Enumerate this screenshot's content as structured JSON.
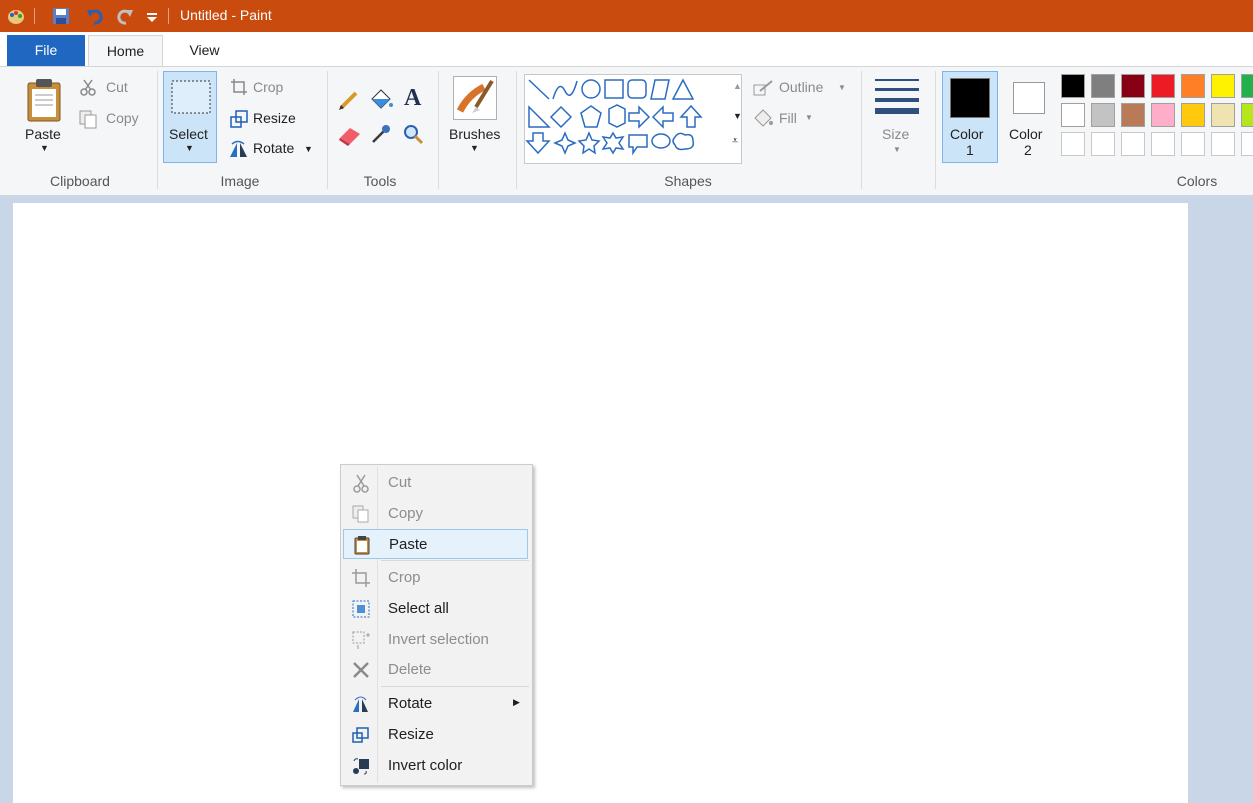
{
  "titlebar": {
    "title": "Untitled - Paint"
  },
  "tabs": {
    "file": "File",
    "home": "Home",
    "view": "View"
  },
  "clipboard": {
    "paste": "Paste",
    "cut": "Cut",
    "copy": "Copy",
    "group": "Clipboard"
  },
  "image": {
    "select": "Select",
    "crop": "Crop",
    "resize": "Resize",
    "rotate": "Rotate",
    "group": "Image"
  },
  "tools": {
    "group": "Tools"
  },
  "brushes": {
    "label": "Brushes"
  },
  "shapes": {
    "outline": "Outline",
    "fill": "Fill",
    "group": "Shapes"
  },
  "size": {
    "label": "Size"
  },
  "colors": {
    "color1_line1": "Color",
    "color1_line2": "1",
    "color2_line1": "Color",
    "color2_line2": "2",
    "group": "Colors",
    "color1": "#000000",
    "color2": "#ffffff",
    "palette_row1": [
      "#000000",
      "#7f7f7f",
      "#880015",
      "#ed1c24",
      "#ff7f27",
      "#fff200",
      "#22b14c"
    ],
    "palette_row2": [
      "#ffffff",
      "#c3c3c3",
      "#b97a57",
      "#ffaec9",
      "#ffc90e",
      "#efe4b0",
      "#b5e61d"
    ]
  },
  "context_menu": {
    "cut": "Cut",
    "copy": "Copy",
    "paste": "Paste",
    "crop": "Crop",
    "select_all": "Select all",
    "invert_selection": "Invert selection",
    "delete": "Delete",
    "rotate": "Rotate",
    "resize": "Resize",
    "invert_color": "Invert color"
  }
}
